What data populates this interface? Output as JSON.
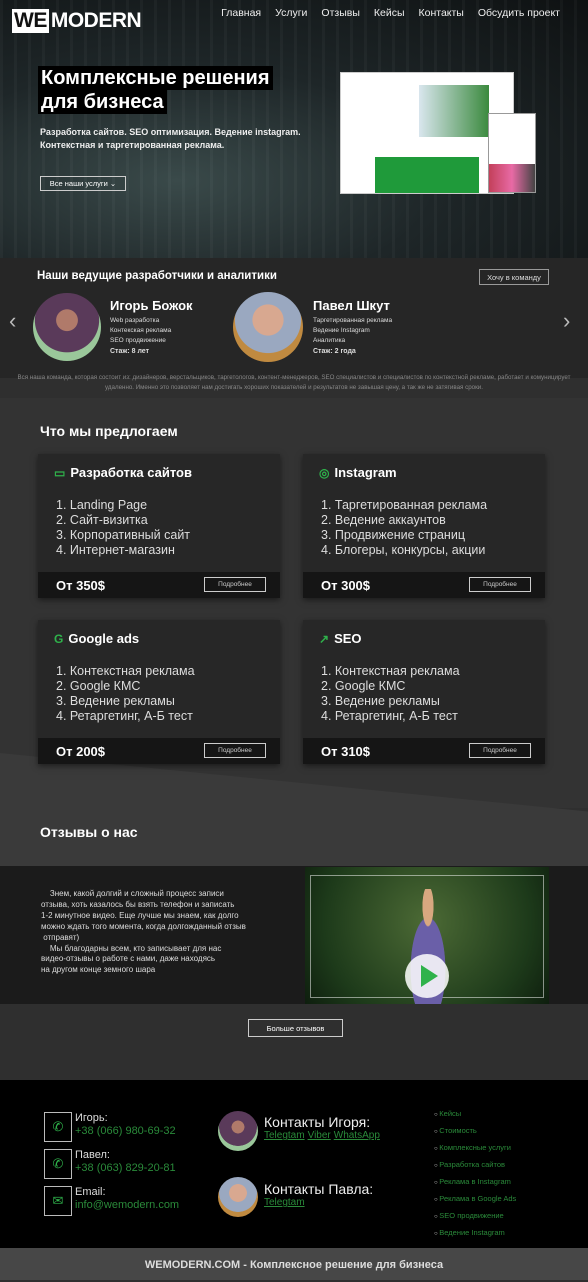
{
  "header": {
    "logo_we": "WE",
    "logo_modern": "MODERN",
    "nav": [
      "Главная",
      "Услуги",
      "Отзывы",
      "Кейсы",
      "Контакты",
      "Обсудить проект"
    ]
  },
  "hero": {
    "title_line1": "Комплексные решения",
    "title_line2": "для бизнеса",
    "subtitle_line1": "Разработка сайтов. SEO оптимизация. Ведение instagram.",
    "subtitle_line2": "Контекстная и таргетированная реклама.",
    "services_button": "Все наши услуги"
  },
  "team": {
    "title": "Наши ведущие разработчики и аналитики",
    "join_button": "Хочу в команду",
    "members": [
      {
        "name": "Игорь Божок",
        "skills": [
          "Web разработка",
          "Контекская реклама",
          "SEO продвижение"
        ],
        "experience": "Стаж: 8 лет"
      },
      {
        "name": "Павел Шкут",
        "skills": [
          "Таргетированная реклама",
          "Ведение Instagram",
          "Аналитика"
        ],
        "experience": "Стаж: 2 года"
      }
    ],
    "note": "Вся наша команда, которая состоит из: дизайнеров, верстальщиков, таргетологов, контент-менеджеров, SEO специалистов и специалистов по контекстной рекламе, работает и комуницирует удаленно. Именно это позволяет нам достигать хороших показателей и результатов не завышая цену, а так же не затягивая сроки."
  },
  "services": {
    "title": "Что мы предлогаем",
    "more_label": "Подробнее",
    "cards": [
      {
        "title": "Разработка сайтов",
        "icon": "laptop-icon",
        "items": [
          "1. Landing Page",
          "2. Сайт-визитка",
          "3. Корпоративный сайт",
          "4. Интернет-магазин"
        ],
        "price": "От 350$"
      },
      {
        "title": "Instagram",
        "icon": "instagram-icon",
        "items": [
          "1. Таргетированная реклама",
          "2. Ведение аккаунтов",
          "3. Продвижение страниц",
          "4. Блогеры, конкурсы, акции"
        ],
        "price": "От 300$"
      },
      {
        "title": "Google ads",
        "icon": "google-icon",
        "items": [
          "1. Контекстная реклама",
          "2. Google КМС",
          "3. Ведение рекламы",
          "4. Ретаргетинг, А-Б тест"
        ],
        "price": "От 200$"
      },
      {
        "title": "SEO",
        "icon": "chart-icon",
        "items": [
          "1. Контекстная реклама",
          "2. Google КМС",
          "3. Ведение рекламы",
          "4. Ретаргетинг, А-Б тест"
        ],
        "price": "От 310$"
      }
    ]
  },
  "reviews": {
    "title": "Отзывы о нас",
    "text": "    Знем, какой долгий и сложный процесс записи\nотзыва, хоть казалось бы взять телефон и записать\n1-2 минутное видео. Еще лучше мы знаем, как долго\nможно ждать того момента, когда долгожданный отзыв\n отправят)\n    Мы благодарны всем, кто записывает для нас\nвидео-отзывы о работе с нами, даже находясь\nна другом конце земного шара",
    "more_button": "Больше отзывов"
  },
  "footer": {
    "contacts": [
      {
        "label": "Игорь:",
        "value": "+38 (066) 980-69-32"
      },
      {
        "label": "Павел:",
        "value": "+38 (063) 829-20-81"
      },
      {
        "label": "Email:",
        "value": "info@wemodern.com"
      }
    ],
    "people": [
      {
        "title": "Контакты Игоря:",
        "links": [
          "Telegtam",
          "Viber",
          "WhatsApp"
        ]
      },
      {
        "title": "Контакты Павла:",
        "links": [
          "Telegtam"
        ]
      }
    ],
    "links": [
      "Кейсы",
      "Стоимость",
      "Комплексные услуги",
      "Разработка сайтов",
      "Реклама в Instagram",
      "Реклама в Google Ads",
      "SEO продвижение",
      "Ведение Instagram"
    ],
    "bottom": "WEMODERN.COM - Комплексное решение для бизнеса"
  },
  "colors": {
    "accent": "#2fb24b"
  }
}
